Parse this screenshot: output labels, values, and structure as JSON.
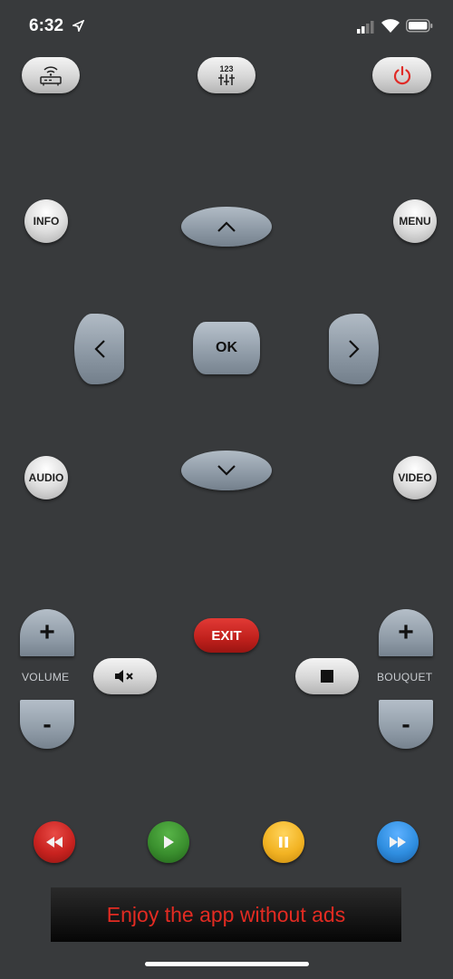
{
  "status_bar": {
    "time": "6:32"
  },
  "top_buttons": {
    "numbers_label": "123"
  },
  "buttons": {
    "info": "INFO",
    "menu": "MENU",
    "ok": "OK",
    "audio": "AUDIO",
    "video": "VIDEO",
    "exit": "EXIT"
  },
  "volume": {
    "label": "VOLUME",
    "plus": "+",
    "minus": "-"
  },
  "bouquet": {
    "label": "BOUQUET",
    "plus": "+",
    "minus": "-"
  },
  "banner": {
    "text": "Enjoy the app without ads"
  },
  "icons": {
    "wifi_remote": "router-icon",
    "numbers": "number-pad-icon",
    "power": "power-icon",
    "up": "chevron-up-icon",
    "down": "chevron-down-icon",
    "left": "chevron-left-icon",
    "right": "chevron-right-icon",
    "mute": "mute-icon",
    "stop": "stop-icon",
    "rewind": "rewind-icon",
    "play": "play-icon",
    "pause": "pause-icon",
    "fast_forward": "fast-forward-icon"
  },
  "colors": {
    "background": "#383a3c",
    "power_red": "#e02b27",
    "exit_red": "#c0201c",
    "rewind_red": "#c8221f",
    "play_green": "#3a8f2e",
    "pause_yellow": "#f2b323",
    "forward_blue": "#2f8ee0",
    "banner_text": "#e32b22"
  }
}
